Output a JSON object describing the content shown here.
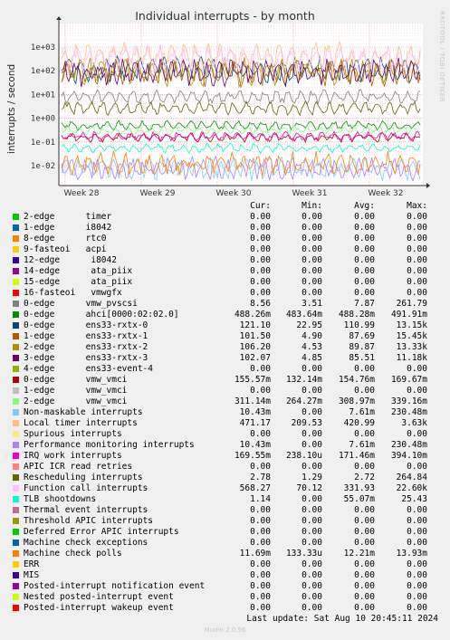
{
  "title": "Individual interrupts - by month",
  "side_label": "RRDTOOL / TOBI OETIKER",
  "footer": "Munin 2.0.56",
  "last_update": "Last update: Sat Aug 10 20:45:11 2024",
  "headers": {
    "cur": "Cur:",
    "min": "Min:",
    "avg": "Avg:",
    "max": "Max:"
  },
  "chart_data": {
    "type": "line",
    "ylabel": "interrupts / second",
    "yscale": "log",
    "ylim": [
      0.005,
      5000
    ],
    "y_ticks": [
      "1e-02",
      "1e-01",
      "1e+00",
      "1e+01",
      "1e+02",
      "1e+03"
    ],
    "x_ticks": [
      "Week 28",
      "Week 29",
      "Week 30",
      "Week 31",
      "Week 32"
    ],
    "series": [
      {
        "name": "2-edge      timer",
        "color": "#00cc00",
        "cur": "0.00",
        "min": "0.00",
        "avg": "0.00",
        "max": "0.00",
        "level": 0
      },
      {
        "name": "1-edge      i8042",
        "color": "#0066b3",
        "cur": "0.00",
        "min": "0.00",
        "avg": "0.00",
        "max": "0.00",
        "level": 0
      },
      {
        "name": "8-edge      rtc0",
        "color": "#ff8000",
        "cur": "0.00",
        "min": "0.00",
        "avg": "0.00",
        "max": "0.00",
        "level": 0
      },
      {
        "name": "9-fasteoi   acpi",
        "color": "#ffcc00",
        "cur": "0.00",
        "min": "0.00",
        "avg": "0.00",
        "max": "0.00",
        "level": 0
      },
      {
        "name": "12-edge      i8042",
        "color": "#330099",
        "cur": "0.00",
        "min": "0.00",
        "avg": "0.00",
        "max": "0.00",
        "level": 0
      },
      {
        "name": "14-edge      ata_piix",
        "color": "#990099",
        "cur": "0.00",
        "min": "0.00",
        "avg": "0.00",
        "max": "0.00",
        "level": 0
      },
      {
        "name": "15-edge      ata_piix",
        "color": "#ccff00",
        "cur": "0.00",
        "min": "0.00",
        "avg": "0.00",
        "max": "0.00",
        "level": 0
      },
      {
        "name": "16-fasteoi   vmwgfx",
        "color": "#ff0000",
        "cur": "0.00",
        "min": "0.00",
        "avg": "0.00",
        "max": "0.00",
        "level": 0
      },
      {
        "name": "0-edge      vmw_pvscsi",
        "color": "#808080",
        "cur": "8.56",
        "min": "3.51",
        "avg": "7.87",
        "max": "261.79",
        "level": 7.87
      },
      {
        "name": "0-edge      ahci[0000:02:02.0]",
        "color": "#008f00",
        "cur": "488.26m",
        "min": "483.64m",
        "avg": "488.28m",
        "max": "491.91m",
        "level": 0.49
      },
      {
        "name": "0-edge      ens33-rxtx-0",
        "color": "#00487d",
        "cur": "121.10",
        "min": "22.95",
        "avg": "110.99",
        "max": "13.15k",
        "level": 111
      },
      {
        "name": "1-edge      ens33-rxtx-1",
        "color": "#b35a00",
        "cur": "101.50",
        "min": "4.90",
        "avg": "87.69",
        "max": "15.45k",
        "level": 87.7
      },
      {
        "name": "2-edge      ens33-rxtx-2",
        "color": "#b38f00",
        "cur": "106.20",
        "min": "4.53",
        "avg": "89.87",
        "max": "13.33k",
        "level": 89.9
      },
      {
        "name": "3-edge      ens33-rxtx-3",
        "color": "#6b006b",
        "cur": "102.07",
        "min": "4.85",
        "avg": "85.51",
        "max": "11.18k",
        "level": 85.5
      },
      {
        "name": "4-edge      ens33-event-4",
        "color": "#8fb300",
        "cur": "0.00",
        "min": "0.00",
        "avg": "0.00",
        "max": "0.00",
        "level": 0
      },
      {
        "name": "0-edge      vmw_vmci",
        "color": "#b30000",
        "cur": "155.57m",
        "min": "132.14m",
        "avg": "154.76m",
        "max": "169.67m",
        "level": 0.155
      },
      {
        "name": "1-edge      vmw_vmci",
        "color": "#bebebe",
        "cur": "0.00",
        "min": "0.00",
        "avg": "0.00",
        "max": "0.00",
        "level": 0
      },
      {
        "name": "2-edge      vmw_vmci",
        "color": "#80ff80",
        "cur": "311.14m",
        "min": "264.27m",
        "avg": "308.97m",
        "max": "339.16m",
        "level": 0.309
      },
      {
        "name": "Non-maskable interrupts",
        "color": "#80c9ff",
        "cur": "10.43m",
        "min": "0.00",
        "avg": "7.61m",
        "max": "230.48m",
        "level": 0.0076
      },
      {
        "name": "Local timer interrupts",
        "color": "#ffc080",
        "cur": "471.17",
        "min": "209.53",
        "avg": "420.99",
        "max": "3.63k",
        "level": 421
      },
      {
        "name": "Spurious interrupts",
        "color": "#ffe680",
        "cur": "0.00",
        "min": "0.00",
        "avg": "0.00",
        "max": "0.00",
        "level": 0
      },
      {
        "name": "Performance monitoring interrupts",
        "color": "#aa80ff",
        "cur": "10.43m",
        "min": "0.00",
        "avg": "7.61m",
        "max": "230.48m",
        "level": 0.0076
      },
      {
        "name": "IRQ work interrupts",
        "color": "#ee00cc",
        "cur": "169.55m",
        "min": "238.10u",
        "avg": "171.46m",
        "max": "394.10m",
        "level": 0.171
      },
      {
        "name": "APIC ICR read retries",
        "color": "#ff8080",
        "cur": "0.00",
        "min": "0.00",
        "avg": "0.00",
        "max": "0.00",
        "level": 0
      },
      {
        "name": "Rescheduling interrupts",
        "color": "#666600",
        "cur": "2.78",
        "min": "1.29",
        "avg": "2.72",
        "max": "264.84",
        "level": 2.72
      },
      {
        "name": "Function call interrupts",
        "color": "#ffbfff",
        "cur": "568.27",
        "min": "70.12",
        "avg": "331.93",
        "max": "22.60k",
        "level": 332
      },
      {
        "name": "TLB shootdowns",
        "color": "#00ffcc",
        "cur": "1.14",
        "min": "0.00",
        "avg": "55.07m",
        "max": "25.43",
        "level": 0.055
      },
      {
        "name": "Thermal event interrupts",
        "color": "#cc6699",
        "cur": "0.00",
        "min": "0.00",
        "avg": "0.00",
        "max": "0.00",
        "level": 0
      },
      {
        "name": "Threshold APIC interrupts",
        "color": "#999900",
        "cur": "0.00",
        "min": "0.00",
        "avg": "0.00",
        "max": "0.00",
        "level": 0
      },
      {
        "name": "Deferred Error APIC interrupts",
        "color": "#00cc00",
        "cur": "0.00",
        "min": "0.00",
        "avg": "0.00",
        "max": "0.00",
        "level": 0
      },
      {
        "name": "Machine check exceptions",
        "color": "#0066b3",
        "cur": "0.00",
        "min": "0.00",
        "avg": "0.00",
        "max": "0.00",
        "level": 0
      },
      {
        "name": "Machine check polls",
        "color": "#ff8000",
        "cur": "11.69m",
        "min": "133.33u",
        "avg": "12.21m",
        "max": "13.93m",
        "level": 0.0122
      },
      {
        "name": "ERR",
        "color": "#ffcc00",
        "cur": "0.00",
        "min": "0.00",
        "avg": "0.00",
        "max": "0.00",
        "level": 0
      },
      {
        "name": "MIS",
        "color": "#330099",
        "cur": "0.00",
        "min": "0.00",
        "avg": "0.00",
        "max": "0.00",
        "level": 0
      },
      {
        "name": "Posted-interrupt notification event",
        "color": "#990099",
        "cur": "0.00",
        "min": "0.00",
        "avg": "0.00",
        "max": "0.00",
        "level": 0
      },
      {
        "name": "Nested posted-interrupt event",
        "color": "#ccff00",
        "cur": "0.00",
        "min": "0.00",
        "avg": "0.00",
        "max": "0.00",
        "level": 0
      },
      {
        "name": "Posted-interrupt wakeup event",
        "color": "#ff0000",
        "cur": "0.00",
        "min": "0.00",
        "avg": "0.00",
        "max": "0.00",
        "level": 0
      }
    ]
  }
}
